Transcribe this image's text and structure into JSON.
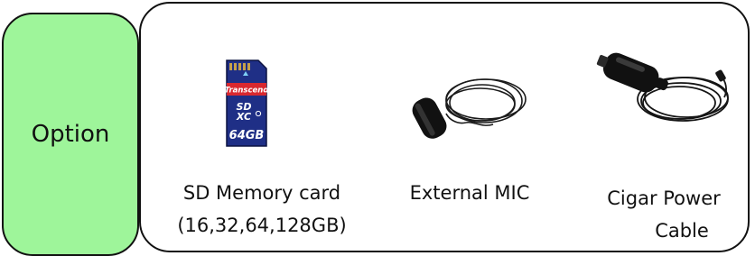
{
  "category": {
    "label": "Option"
  },
  "items": [
    {
      "name_lines": [
        "SD Memory card",
        "(16,32,64,128GB)"
      ],
      "image": {
        "type": "sd-card-photo",
        "brand": "Transcend",
        "card_marks": [
          "SD",
          "XC"
        ],
        "capacity": "64GB",
        "colors": {
          "card": "#1f2f86",
          "brand_band": "#d9282f"
        }
      }
    },
    {
      "name_lines": [
        "External MIC"
      ],
      "image": {
        "type": "microphone-photo"
      }
    },
    {
      "name_lines": [
        "Cigar Power",
        "Cable"
      ],
      "image": {
        "type": "cigar-power-cable-photo"
      }
    }
  ]
}
